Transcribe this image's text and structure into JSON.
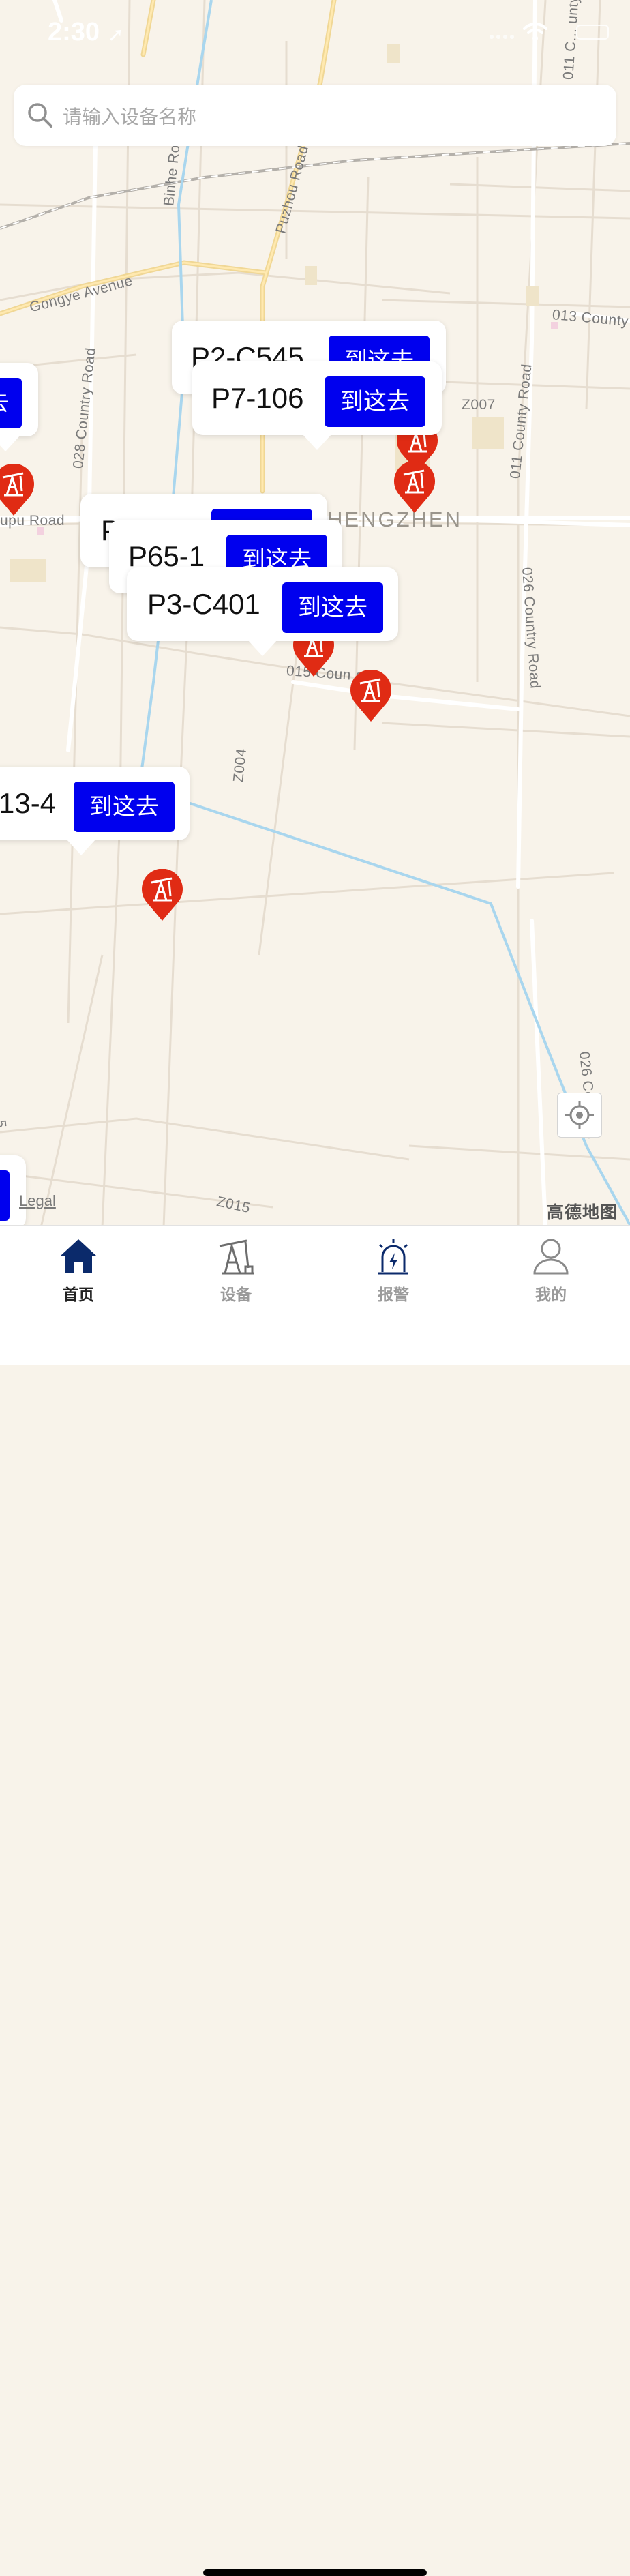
{
  "status_bar": {
    "time": "2:30",
    "location_glyph": "➚"
  },
  "search": {
    "placeholder": "请输入设备名称"
  },
  "map": {
    "road_labels": [
      "Gongye Avenue",
      "Puzhou Road",
      "Binhe Ro",
      "028 Country Road",
      "011 County Road",
      "011 C... unty",
      "013 County",
      "Z007",
      "026 Country Road",
      "015 Coun   ad",
      "Z004",
      "026 Co   Road",
      "Z015",
      "upu Road",
      "5",
      "5"
    ],
    "town_label": "HENGZHEN",
    "legal": "Legal",
    "provider": "高德地图"
  },
  "markers": [
    {
      "name": "P2-C545",
      "action": "到这去"
    },
    {
      "name": "P7-106",
      "action": "到这去"
    },
    {
      "name": "",
      "action": "去"
    },
    {
      "name": "P3-181",
      "action": "到这去"
    },
    {
      "name": "P65-1",
      "action": "到这去"
    },
    {
      "name": "P3-C401",
      "action": "到这去"
    },
    {
      "name": "13-4",
      "action": "到这去"
    }
  ],
  "tabs": [
    {
      "label": "首页",
      "icon": "home-icon",
      "active": true
    },
    {
      "label": "设备",
      "icon": "pumpjack-icon",
      "active": false
    },
    {
      "label": "报警",
      "icon": "alarm-icon",
      "active": false
    },
    {
      "label": "我的",
      "icon": "user-icon",
      "active": false
    }
  ],
  "colors": {
    "accent": "#0000ee",
    "pin": "#e02b14",
    "tab_active": "#0b2a6b",
    "map_bg": "#f8f3ea"
  }
}
